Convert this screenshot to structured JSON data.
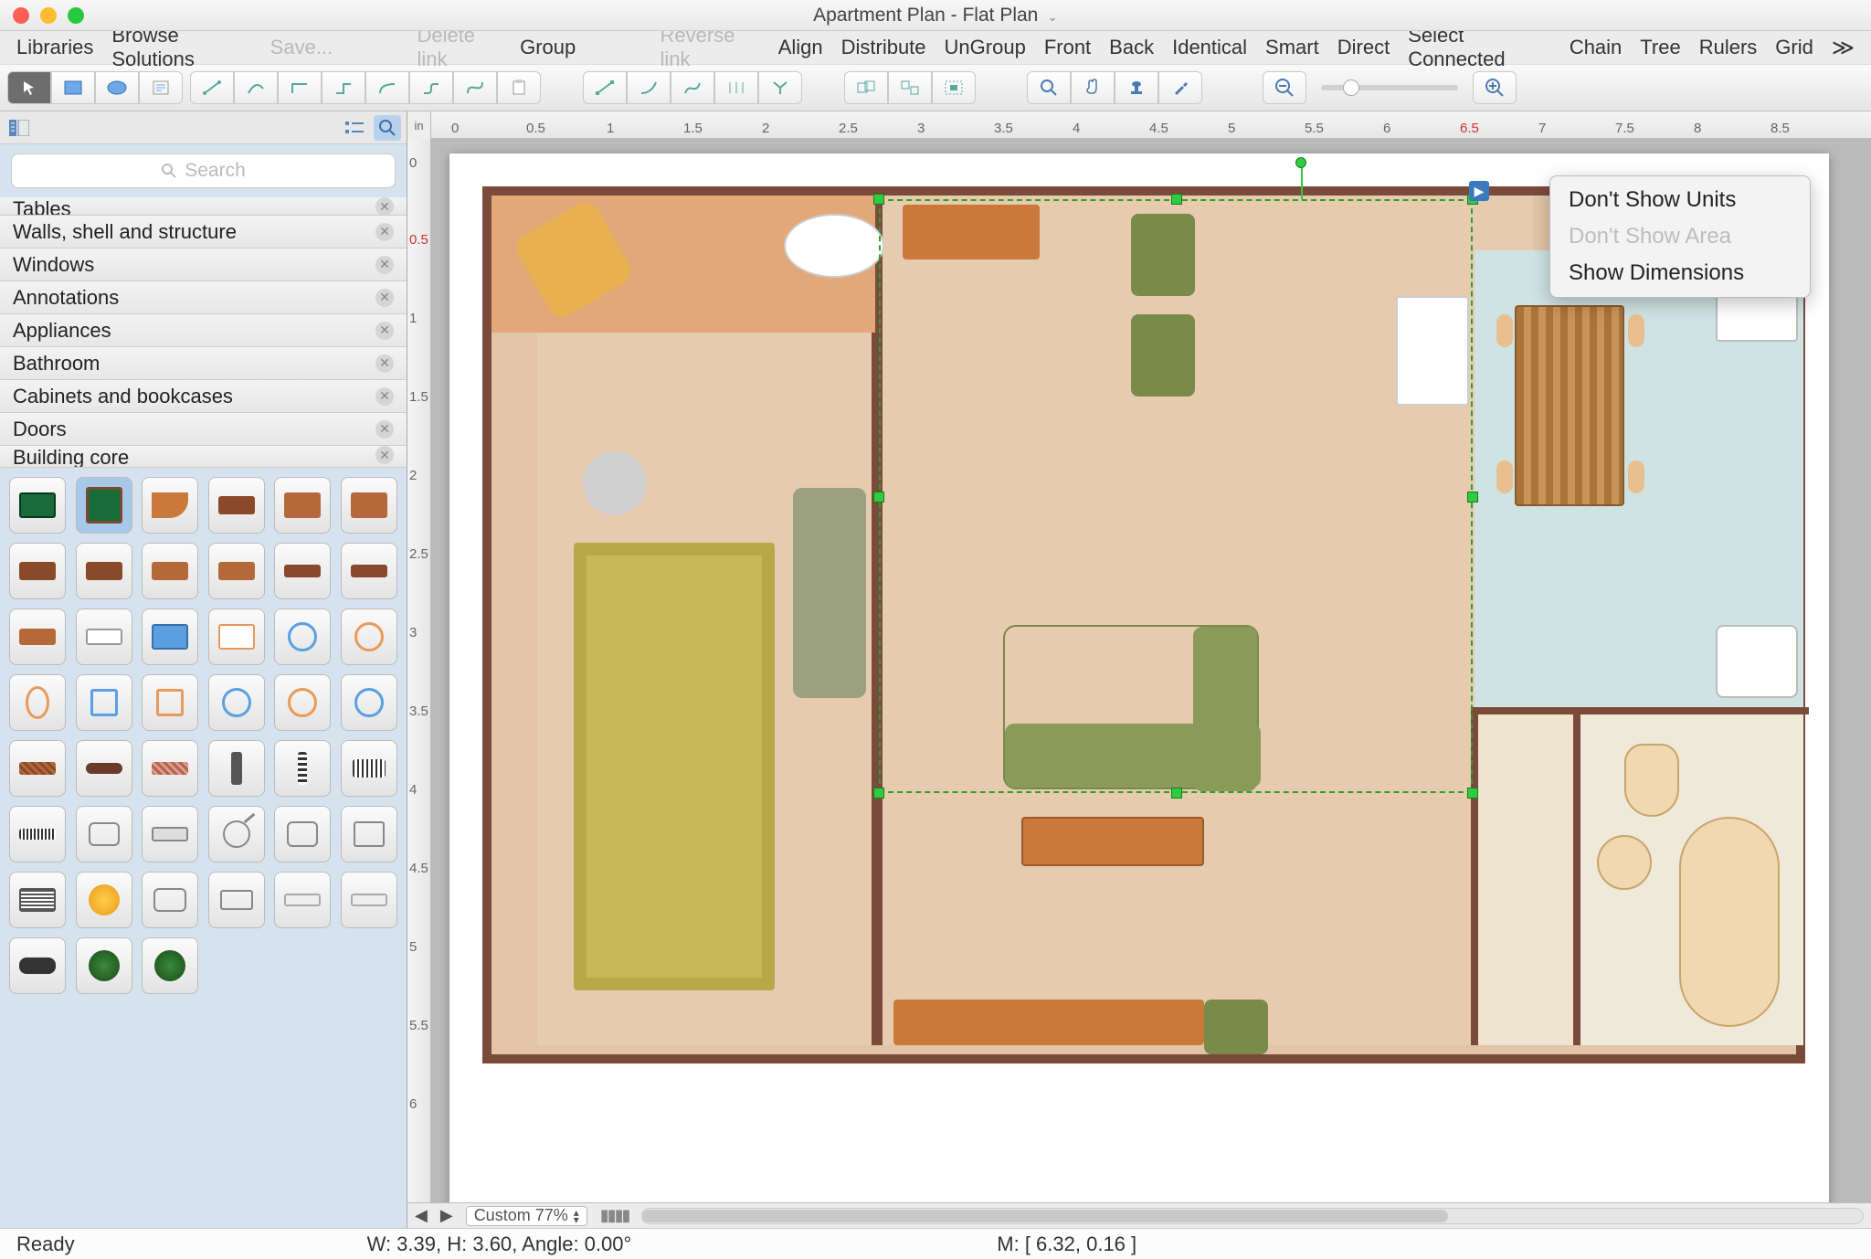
{
  "title": "Apartment Plan - Flat Plan",
  "menubar": {
    "libraries": "Libraries",
    "browse": "Browse Solutions",
    "save": "Save...",
    "deletelink": "Delete link",
    "group": "Group",
    "reverselink": "Reverse link",
    "align": "Align",
    "distribute": "Distribute",
    "ungroup": "UnGroup",
    "front": "Front",
    "back": "Back",
    "identical": "Identical",
    "smart": "Smart",
    "direct": "Direct",
    "selectconnected": "Select Connected",
    "chain": "Chain",
    "tree": "Tree",
    "rulers": "Rulers",
    "grid": "Grid"
  },
  "search_placeholder": "Search",
  "libraries_list": {
    "i0": "Tables",
    "i1": "Walls, shell and structure",
    "i2": "Windows",
    "i3": "Annotations",
    "i4": "Appliances",
    "i5": "Bathroom",
    "i6": "Cabinets and bookcases",
    "i7": "Doors",
    "i8": "Building core"
  },
  "ruler_unit": "in",
  "ruler_h": [
    "0",
    "0.5",
    "1",
    "1.5",
    "2",
    "2.5",
    "3",
    "3.5",
    "4",
    "4.5",
    "5",
    "5.5",
    "6",
    "6.5",
    "7",
    "7.5",
    "8",
    "8.5"
  ],
  "ruler_v": [
    "0",
    "0.5",
    "1",
    "1.5",
    "2",
    "2.5",
    "3",
    "3.5",
    "4",
    "4.5",
    "5",
    "5.5",
    "6"
  ],
  "context_menu": {
    "m1": "Don't Show Units",
    "m2": "Don't Show Area",
    "m3": "Show Dimensions"
  },
  "zoom_label": "Custom 77%",
  "statusbar": {
    "ready": "Ready",
    "dims": "W: 3.39,  H: 3.60,  Angle: 0.00°",
    "mouse": "M: [ 6.32, 0.16 ]"
  }
}
